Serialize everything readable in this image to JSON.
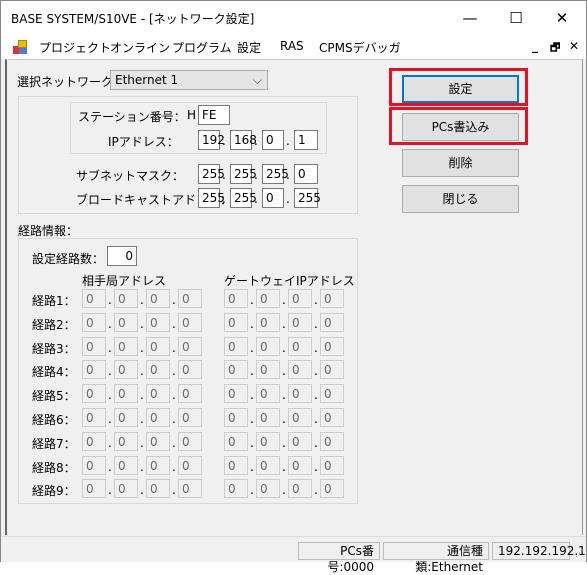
{
  "window": {
    "title": "BASE SYSTEM/S10VE - [ネットワーク設定]",
    "minimize": "—",
    "maximize": "☐",
    "close": "✕"
  },
  "menu": {
    "items": [
      "プロジェクト",
      "オンライン",
      "プログラム",
      "設定",
      "RAS",
      "CPMSデバッガ"
    ],
    "mdi": [
      "_",
      "🗗",
      "✕"
    ]
  },
  "network": {
    "label": "選択ネットワーク：",
    "selected": "Ethernet 1",
    "station_label": "ステーション番号：",
    "station_prefix": "H",
    "station": "FE",
    "ip_label": "IPアドレス：",
    "ip": [
      "192",
      "168",
      "0",
      "1"
    ],
    "subnet_label": "サブネットマスク：",
    "subnet": [
      "255",
      "255",
      "255",
      "0"
    ],
    "broadcast_label": "ブロードキャストアドレス：",
    "broadcast": [
      "255",
      "255",
      "0",
      "255"
    ]
  },
  "route": {
    "label": "経路情報：",
    "count_label": "設定経路数：",
    "count": "0",
    "dest_header": "相手局アドレス",
    "gw_header": "ゲートウェイIPアドレス",
    "rows": [
      {
        "label": "経路1：",
        "dest": [
          "0",
          "0",
          "0",
          "0"
        ],
        "gw": [
          "0",
          "0",
          "0",
          "0"
        ]
      },
      {
        "label": "経路2：",
        "dest": [
          "0",
          "0",
          "0",
          "0"
        ],
        "gw": [
          "0",
          "0",
          "0",
          "0"
        ]
      },
      {
        "label": "経路3：",
        "dest": [
          "0",
          "0",
          "0",
          "0"
        ],
        "gw": [
          "0",
          "0",
          "0",
          "0"
        ]
      },
      {
        "label": "経路4：",
        "dest": [
          "0",
          "0",
          "0",
          "0"
        ],
        "gw": [
          "0",
          "0",
          "0",
          "0"
        ]
      },
      {
        "label": "経路5：",
        "dest": [
          "0",
          "0",
          "0",
          "0"
        ],
        "gw": [
          "0",
          "0",
          "0",
          "0"
        ]
      },
      {
        "label": "経路6：",
        "dest": [
          "0",
          "0",
          "0",
          "0"
        ],
        "gw": [
          "0",
          "0",
          "0",
          "0"
        ]
      },
      {
        "label": "経路7：",
        "dest": [
          "0",
          "0",
          "0",
          "0"
        ],
        "gw": [
          "0",
          "0",
          "0",
          "0"
        ]
      },
      {
        "label": "経路8：",
        "dest": [
          "0",
          "0",
          "0",
          "0"
        ],
        "gw": [
          "0",
          "0",
          "0",
          "0"
        ]
      },
      {
        "label": "経路9：",
        "dest": [
          "0",
          "0",
          "0",
          "0"
        ],
        "gw": [
          "0",
          "0",
          "0",
          "0"
        ]
      }
    ]
  },
  "buttons": {
    "set": "設定",
    "write": "PCs書込み",
    "delete": "削除",
    "close": "閉じる"
  },
  "status": {
    "pcs": "PCs番号:0000",
    "comm": "通信種類:Ethernet",
    "ip": "192.192.192.1"
  },
  "colors": {
    "highlight": "#e81123",
    "focus": "#0078d7"
  }
}
